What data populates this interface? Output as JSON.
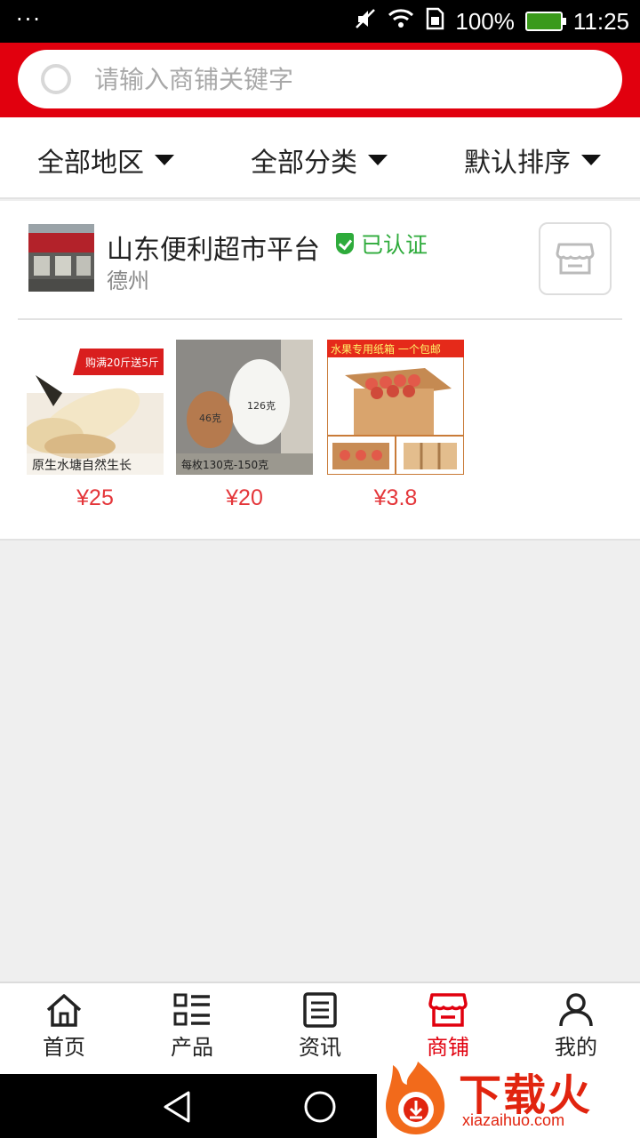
{
  "status_bar": {
    "battery": "100%",
    "time": "11:25"
  },
  "search": {
    "placeholder": "请输入商铺关键字"
  },
  "filters": [
    {
      "label": "全部地区"
    },
    {
      "label": "全部分类"
    },
    {
      "label": "默认排序"
    }
  ],
  "shop": {
    "name": "山东便利超市平台",
    "verified_label": "已认证",
    "city": "德州",
    "products": [
      {
        "price": "¥25",
        "image_text": "原生水塘自然生长",
        "badge": "购满20斤送5斤"
      },
      {
        "price": "¥20",
        "image_text": "每枚130克-150克"
      },
      {
        "price": "¥3.8",
        "image_text": "水果专用纸箱 一个包邮"
      }
    ]
  },
  "bottom_nav": [
    {
      "label": "首页",
      "icon": "home-icon"
    },
    {
      "label": "产品",
      "icon": "list-icon"
    },
    {
      "label": "资讯",
      "icon": "news-icon"
    },
    {
      "label": "商铺",
      "icon": "store-icon",
      "active": true
    },
    {
      "label": "我的",
      "icon": "user-icon"
    }
  ],
  "watermark": {
    "text": "下载火",
    "url": "xiazaihuo.com"
  },
  "colors": {
    "brand_red": "#e1000e",
    "price_red": "#e4363a",
    "verified_green": "#2eab3b"
  }
}
